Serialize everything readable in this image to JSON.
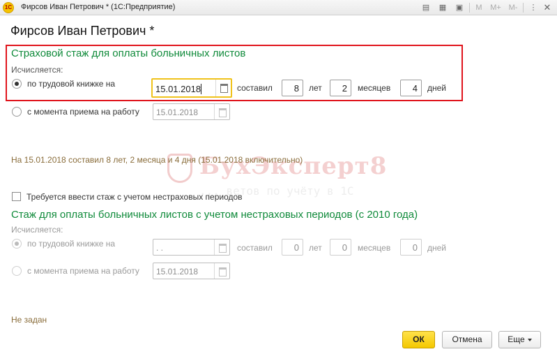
{
  "window": {
    "title": "Фирсов Иван Петрович * (1С:Предприятие)",
    "logo": "1С",
    "toolbar": [
      "M",
      "M+",
      "M-"
    ]
  },
  "heading": "Фирсов Иван Петрович *",
  "section1": {
    "title": "Страховой стаж для оплаты больничных листов",
    "computed_label": "Исчисляется:",
    "option_book": {
      "label": "по трудовой книжке на",
      "date": "15.01.2018",
      "total_label": "составил",
      "years": "8",
      "years_label": "лет",
      "months": "2",
      "months_label": "месяцев",
      "days": "4",
      "days_label": "дней"
    },
    "option_hire": {
      "label": "с момента приема на работу",
      "date": "15.01.2018"
    },
    "summary": "На 15.01.2018 составил 8 лет, 2 месяца и 4 дня (15.01.2018 включительно)"
  },
  "watermark": {
    "title": "БухЭксперт8",
    "subtitle": "... ветов по учёту в 1С"
  },
  "checkbox_label": "Требуется ввести стаж с учетом нестраховых периодов",
  "section2": {
    "title": "Стаж для оплаты больничных листов с учетом нестраховых периодов (с 2010 года)",
    "computed_label": "Исчисляется:",
    "option_book": {
      "label": "по трудовой книжке на",
      "date": " . .",
      "total_label": "составил",
      "years": "0",
      "years_label": "лет",
      "months": "0",
      "months_label": "месяцев",
      "days": "0",
      "days_label": "дней"
    },
    "option_hire": {
      "label": "с момента приема на работу",
      "date": "15.01.2018"
    },
    "status": "Не задан"
  },
  "buttons": {
    "ok": "ОК",
    "cancel": "Отмена",
    "more": "Еще"
  },
  "colors": {
    "section_title": "#0f8a3a",
    "highlight_border": "#e0141c",
    "ok_button": "#f4c800",
    "focus_border": "#f0c21a"
  }
}
